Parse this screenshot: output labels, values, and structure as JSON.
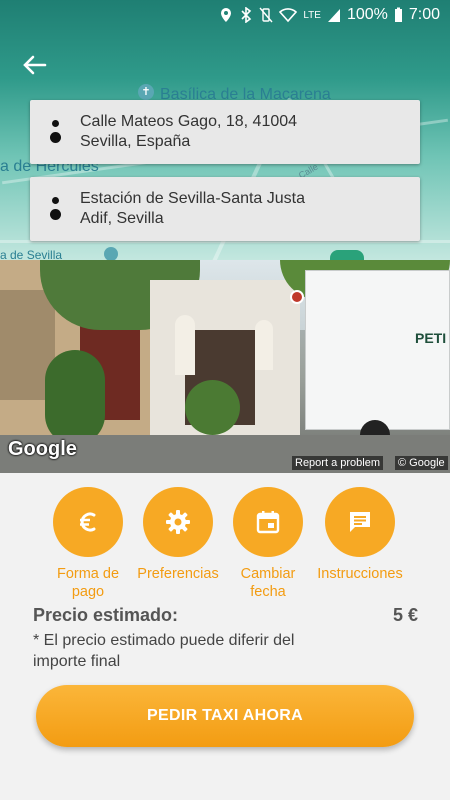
{
  "status_bar": {
    "network": "LTE",
    "battery": "100%",
    "time": "7:00"
  },
  "map": {
    "labels": [
      "Basílica de la Macarena",
      "a de Hercules",
      "Calle",
      "a de Sevilla"
    ]
  },
  "route": {
    "origin": {
      "line1": "Calle Mateos Gago, 18, 41004",
      "line2": "Sevilla, España"
    },
    "destination": {
      "line1": "Estación de Sevilla-Santa Justa",
      "line2": "Adif, Sevilla"
    }
  },
  "street_view": {
    "logo": "Google",
    "report": "Report a problem",
    "copyright": "© Google"
  },
  "actions": [
    {
      "label_line1": "Forma de",
      "label_line2": "pago",
      "icon": "euro-icon"
    },
    {
      "label_line1": "Preferencias",
      "label_line2": "",
      "icon": "gear-icon"
    },
    {
      "label_line1": "Cambiar",
      "label_line2": "fecha",
      "icon": "calendar-icon"
    },
    {
      "label_line1": "Instrucciones",
      "label_line2": "",
      "icon": "message-icon"
    }
  ],
  "price": {
    "label": "Precio estimado:",
    "value": "5 €",
    "note": "* El precio estimado puede diferir del importe final"
  },
  "cta_label": "PEDIR TAXI AHORA",
  "colors": {
    "accent": "#f7a924",
    "accent_text": "#f39c12",
    "map_teal": "#2f9a8a"
  }
}
